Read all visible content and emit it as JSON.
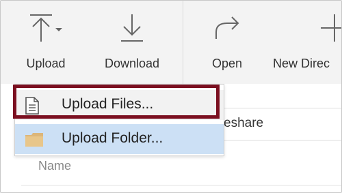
{
  "toolbar": {
    "upload_label": "Upload",
    "download_label": "Download",
    "open_label": "Open",
    "new_directory_label": "New Direc"
  },
  "upload_menu": {
    "items": [
      {
        "label": "Upload Files...",
        "icon": "document-icon",
        "selected": false
      },
      {
        "label": "Upload Folder...",
        "icon": "folder-icon",
        "selected": true
      }
    ]
  },
  "path": {
    "text": "eshare"
  },
  "file_list": {
    "columns": [
      "Name"
    ]
  },
  "colors": {
    "accent_highlight": "#7b0f20",
    "selected_item": "#cce0f5",
    "toolbar_bg": "#f3f3f3",
    "icon_stroke": "#666666",
    "folder_fill": "#dcb67a"
  }
}
